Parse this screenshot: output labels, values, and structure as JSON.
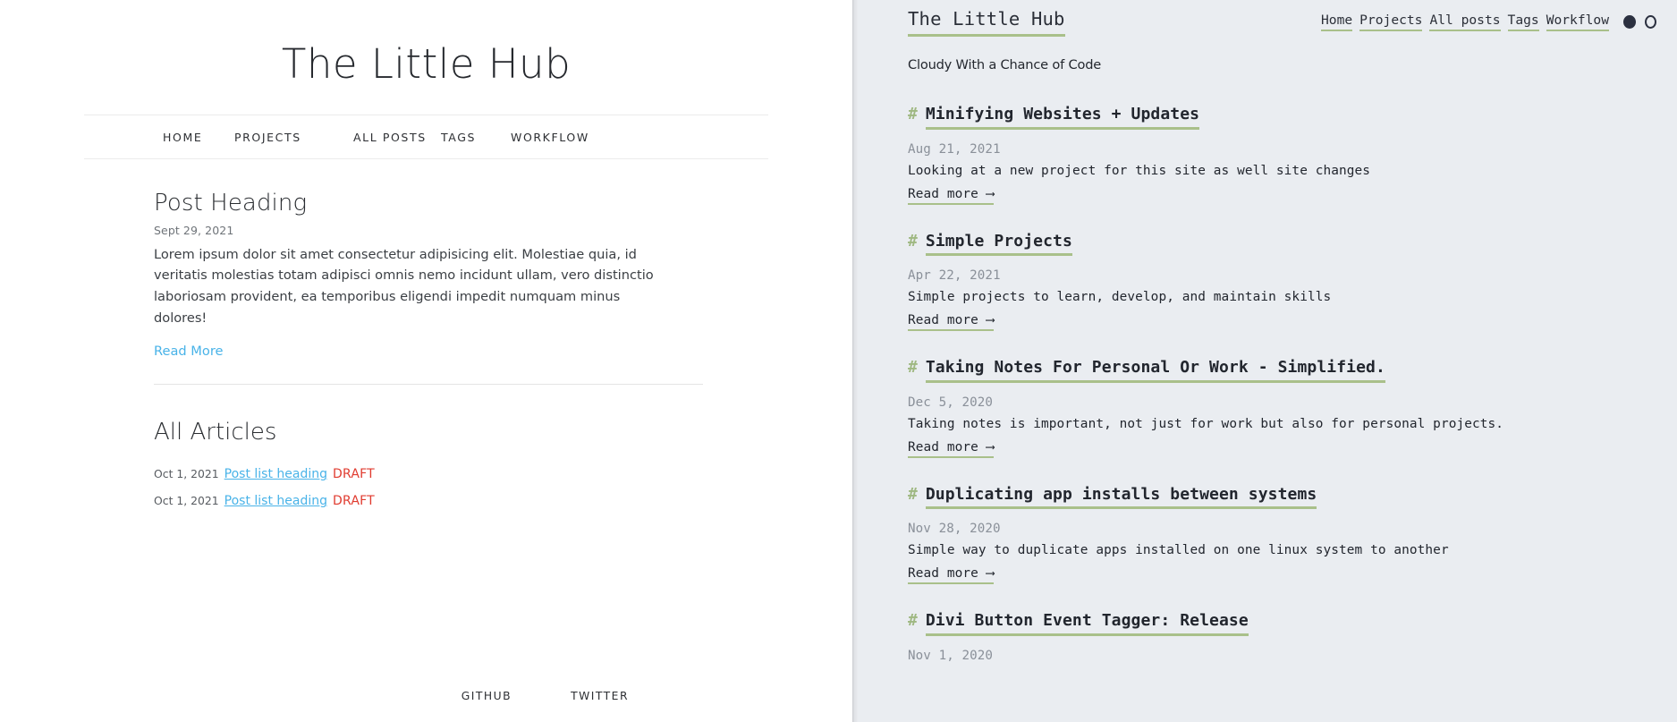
{
  "left_panel": {
    "site_title": "The Little Hub",
    "nav": [
      {
        "label": "HOME"
      },
      {
        "label": "PROJECTS"
      },
      {
        "label": "ALL POSTS"
      },
      {
        "label": "TAGS"
      },
      {
        "label": "WORKFLOW"
      }
    ],
    "featured_post": {
      "heading": "Post Heading",
      "date": "Sept 29, 2021",
      "excerpt": "Lorem ipsum dolor sit amet consectetur adipisicing elit. Molestiae quia, id veritatis molestias totam adipisci omnis nemo incidunt ullam, vero distinctio laboriosam provident, ea temporibus eligendi impedit numquam minus dolores!",
      "read_more": "Read More"
    },
    "all_articles_heading": "All Articles",
    "articles": [
      {
        "date": "Oct 1, 2021",
        "title": "Post list heading",
        "status": "DRAFT"
      },
      {
        "date": "Oct 1, 2021",
        "title": "Post list heading",
        "status": "DRAFT"
      }
    ],
    "footer": [
      {
        "label": "GITHUB"
      },
      {
        "label": "TWITTER"
      }
    ],
    "colors": {
      "link": "#49b3e8",
      "draft": "#e03b2f",
      "background": "#ffffff"
    }
  },
  "right_panel": {
    "site_title": "The Little Hub",
    "tagline": "Cloudy With a Chance of Code",
    "nav": [
      {
        "label": "Home"
      },
      {
        "label": "Projects"
      },
      {
        "label": "All posts"
      },
      {
        "label": "Tags"
      },
      {
        "label": "Workflow"
      }
    ],
    "theme_toggle": {
      "dark_icon": "filled-circle-icon",
      "light_icon": "hollow-circle-icon"
    },
    "hash_symbol": "#",
    "read_more_label": "Read more ⟶",
    "posts": [
      {
        "title": "Minifying Websites + Updates",
        "date": "Aug 21, 2021",
        "description": "Looking at a new project for this site as well site changes",
        "read_more": "Read more ⟶"
      },
      {
        "title": "Simple Projects",
        "date": "Apr 22, 2021",
        "description": "Simple projects to learn, develop, and maintain skills",
        "read_more": "Read more ⟶"
      },
      {
        "title": "Taking Notes For Personal Or Work - Simplified.",
        "date": "Dec 5, 2020",
        "description": "Taking notes is important, not just for work but also for personal projects.",
        "read_more": "Read more ⟶"
      },
      {
        "title": "Duplicating app installs between systems",
        "date": "Nov 28, 2020",
        "description": "Simple way to duplicate apps installed on one linux system to another",
        "read_more": "Read more ⟶"
      },
      {
        "title": "Divi Button Event Tagger: Release",
        "date": "Nov 1, 2020",
        "description": "",
        "read_more": ""
      }
    ],
    "colors": {
      "background": "#eaedf1",
      "accent_underline": "#a9c08a",
      "text": "#22262e",
      "muted_text": "#8a9099"
    }
  }
}
